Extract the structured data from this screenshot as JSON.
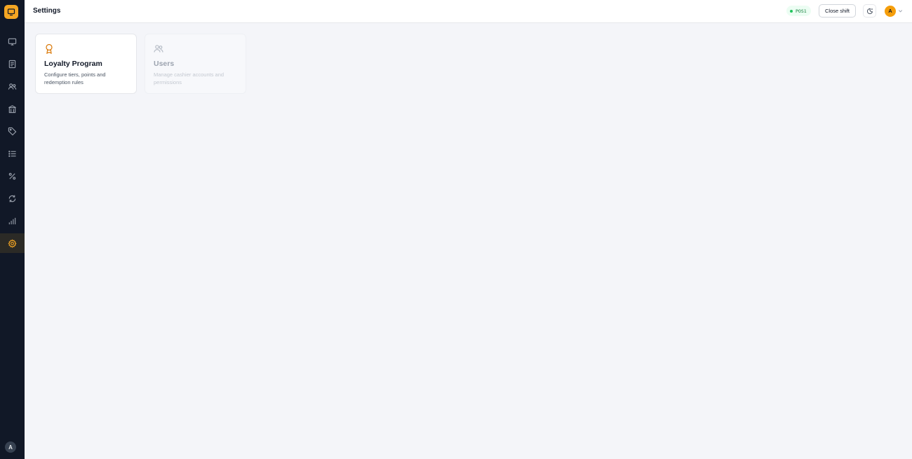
{
  "header": {
    "title": "Settings",
    "terminal": "POS1",
    "close_shift_label": "Close shift",
    "user_initial": "A"
  },
  "sidebar": {
    "items": [
      {
        "icon": "monitor-icon",
        "active": false
      },
      {
        "icon": "receipt-icon",
        "active": false
      },
      {
        "icon": "users-icon",
        "active": false
      },
      {
        "icon": "store-icon",
        "active": false
      },
      {
        "icon": "tag-icon",
        "active": false
      },
      {
        "icon": "list-icon",
        "active": false
      },
      {
        "icon": "percent-icon",
        "active": false
      },
      {
        "icon": "sync-icon",
        "active": false
      },
      {
        "icon": "bar-chart-icon",
        "active": false
      },
      {
        "icon": "gear-icon",
        "active": true
      }
    ],
    "user_initial": "A"
  },
  "cards": [
    {
      "icon": "award-icon",
      "title": "Loyalty Program",
      "description": "Configure tiers, points and redemption rules"
    },
    {
      "icon": "users-icon",
      "title": "Users",
      "description": "Manage cashier accounts and permissions"
    }
  ],
  "colors": {
    "accent": "#f5a623",
    "sidebar_bg": "#111827",
    "page_bg": "#f4f5f9",
    "status_green": "#22c55e"
  }
}
